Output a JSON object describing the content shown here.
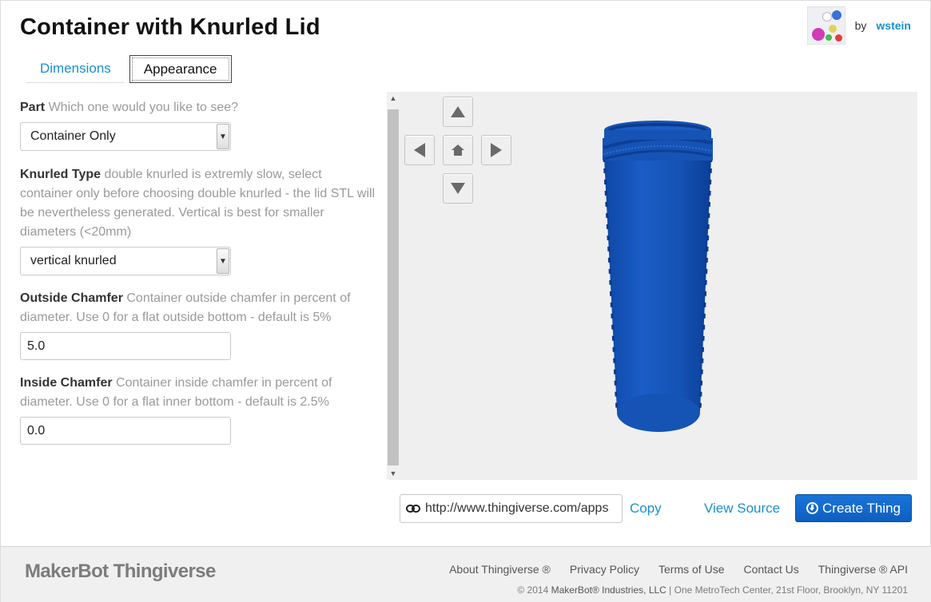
{
  "header": {
    "title": "Container with Knurled Lid",
    "by_label": "by",
    "author": "wstein"
  },
  "tabs": [
    {
      "label": "Dimensions",
      "active": false
    },
    {
      "label": "Appearance",
      "active": true
    }
  ],
  "params": [
    {
      "name": "Part",
      "description": "Which one would you like to see?",
      "control": "select",
      "value": "Container Only"
    },
    {
      "name": "Knurled Type",
      "description": "double knurled is extremly slow, select container only before choosing double knurled - the lid STL will be nevertheless generated. Vertical is best for smaller diameters (<20mm)",
      "control": "select",
      "value": "vertical knurled"
    },
    {
      "name": "Outside Chamfer",
      "description": "Container outside chamfer in percent of diameter. Use 0 for a flat outside bottom - default is 5%",
      "control": "input",
      "value": "5.0"
    },
    {
      "name": "Inside Chamfer",
      "description": "Container inside chamfer in percent of diameter. Use 0 for a flat inner bottom - default is 2.5%",
      "control": "input",
      "value": "0.0"
    }
  ],
  "viewer": {
    "model_color": "#1553b5",
    "background": "#efefef",
    "nav_icons": [
      "arrow-up-icon",
      "arrow-left-icon",
      "home-icon",
      "arrow-right-icon",
      "arrow-down-icon"
    ]
  },
  "actions": {
    "url": "http://www.thingiverse.com/apps",
    "copy_label": "Copy",
    "view_source_label": "View Source",
    "create_label": "Create Thing",
    "accent": "#1a8fd0",
    "button_color": "#1468d0"
  },
  "footer": {
    "logo": "MakerBot Thingiverse",
    "links": [
      "About Thingiverse ®",
      "Privacy Policy",
      "Terms of Use",
      "Contact Us",
      "Thingiverse ® API"
    ],
    "copyright_prefix": "© 2014",
    "company": "MakerBot® Industries, LLC",
    "address": "| One MetroTech Center, 21st Floor, Brooklyn, NY 11201"
  }
}
